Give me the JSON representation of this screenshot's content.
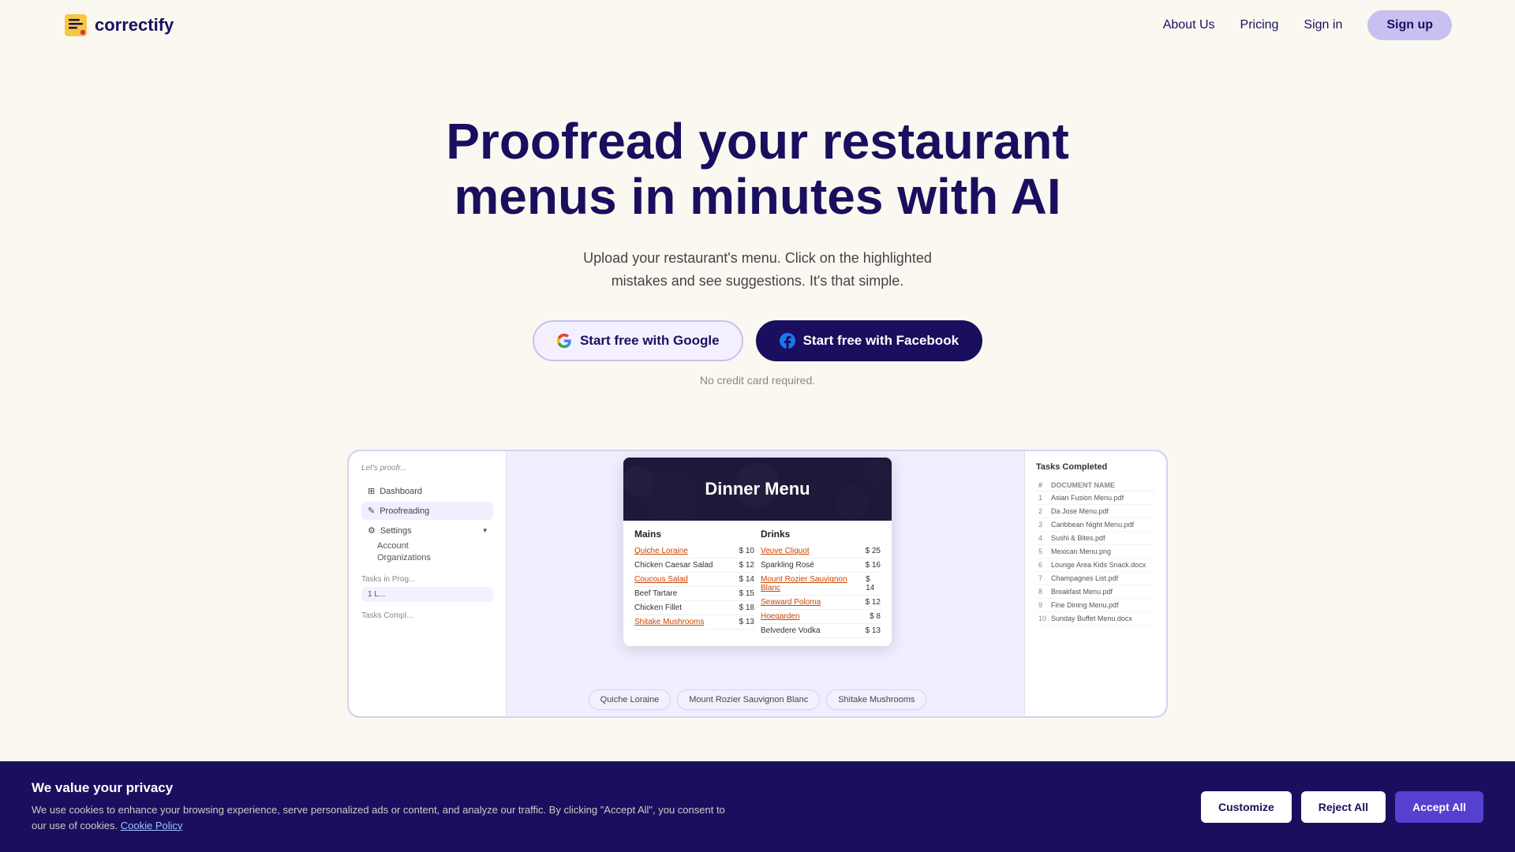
{
  "nav": {
    "logo_text": "correctify",
    "links": [
      {
        "label": "About Us",
        "id": "about-us"
      },
      {
        "label": "Pricing",
        "id": "pricing"
      },
      {
        "label": "Sign in",
        "id": "sign-in"
      }
    ],
    "signup_label": "Sign up"
  },
  "hero": {
    "title": "Proofread your restaurant menus in minutes with AI",
    "subtitle": "Upload your restaurant's menu. Click on the highlighted mistakes and see suggestions. It's that simple.",
    "btn_google": "Start free with Google",
    "btn_facebook": "Start free with Facebook",
    "no_cc": "No credit card required."
  },
  "preview": {
    "menu": {
      "title": "Dinner Menu",
      "mains_header": "Mains",
      "drinks_header": "Drinks",
      "mains": [
        {
          "name": "Quiche Loraine",
          "price": "$ 10",
          "linked": true
        },
        {
          "name": "Chicken Caesar Salad",
          "price": "$ 12",
          "linked": false
        },
        {
          "name": "Coucous Salad",
          "price": "$ 14",
          "linked": true
        },
        {
          "name": "Beef Tartare",
          "price": "$ 15",
          "linked": false
        },
        {
          "name": "Chicken Fillet",
          "price": "$ 18",
          "linked": false
        },
        {
          "name": "Shitake Mushrooms",
          "price": "$ 13",
          "linked": true
        }
      ],
      "drinks": [
        {
          "name": "Veuve Cliquot",
          "price": "$ 25",
          "linked": true
        },
        {
          "name": "Sparkling Rosé",
          "price": "$ 16",
          "linked": false
        },
        {
          "name": "Mount Rozier Sauvignon Blanc",
          "price": "$ 14",
          "linked": true
        },
        {
          "name": "Seaward Poloma",
          "price": "$ 12",
          "linked": true
        },
        {
          "name": "Hoegarden",
          "price": "$ 8",
          "linked": true
        },
        {
          "name": "Belvedere Vodka",
          "price": "$ 13",
          "linked": false
        }
      ]
    },
    "tags": [
      "Quiche Loraine",
      "Mount Rozier Sauvignon Blanc",
      "Shitake Mushrooms"
    ],
    "left_panel": {
      "proofreading_label": "Let's proofr...",
      "nav_items": [
        {
          "label": "Dashboard"
        },
        {
          "label": "Proofreading"
        },
        {
          "label": "Settings"
        }
      ],
      "sub_items": [
        "Account",
        "Organizations"
      ],
      "tasks_in_progress": "Tasks in Prog...",
      "task_item": "1  L...",
      "tasks_complete": "Tasks Compl..."
    },
    "right_panel": {
      "header": "Tasks Completed",
      "col_num": "#",
      "col_name": "DOCUMENT NAME",
      "rows": [
        {
          "num": "1",
          "name": "Asian Fusion Menu.pdf"
        },
        {
          "num": "2",
          "name": "Da Jose Menu.pdf"
        },
        {
          "num": "3",
          "name": "Caribbean Night Menu.pdf"
        },
        {
          "num": "4",
          "name": "Sushi & Bites.pdf"
        },
        {
          "num": "5",
          "name": "Mexican Menu.png"
        },
        {
          "num": "6",
          "name": "Lounge Area Kids Snack.docx"
        },
        {
          "num": "7",
          "name": "Champagnes List.pdf"
        },
        {
          "num": "8",
          "name": "Breakfast Menu.pdf"
        },
        {
          "num": "9",
          "name": "Fine Dining Menu.pdf"
        },
        {
          "num": "10",
          "name": "Sunday Buffet Menu.docx"
        }
      ]
    }
  },
  "cookie": {
    "title": "We value your privacy",
    "text": "We use cookies to enhance your browsing experience, serve personalized ads or content, and analyze our traffic. By clicking \"Accept All\", you consent to our use of cookies.",
    "policy_link": "Cookie Policy",
    "btn_customize": "Customize",
    "btn_reject": "Reject All",
    "btn_accept": "Accept All"
  },
  "colors": {
    "primary": "#1a0f5e",
    "accent": "#5540d0",
    "light_purple": "#c8c0f0",
    "bg": "#faf8f0"
  }
}
